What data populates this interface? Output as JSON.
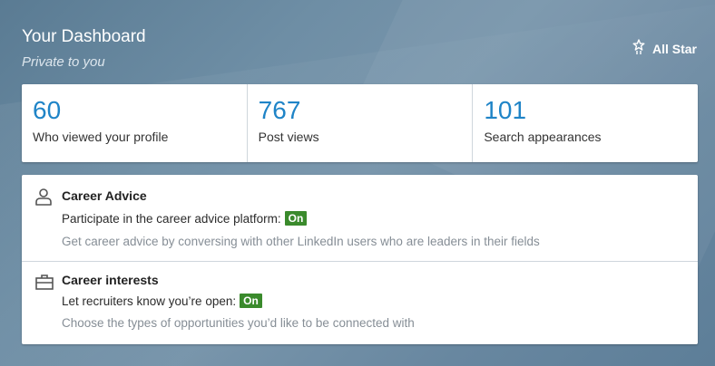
{
  "header": {
    "title": "Your Dashboard",
    "subtitle": "Private to you",
    "all_star_label": "All Star",
    "all_star_icon": "star-award-icon"
  },
  "stats": [
    {
      "value": "60",
      "label": "Who viewed your profile"
    },
    {
      "value": "767",
      "label": "Post views"
    },
    {
      "value": "101",
      "label": "Search appearances"
    }
  ],
  "career_advice": {
    "icon": "person-icon",
    "title": "Career Advice",
    "line": "Participate in the career advice platform:",
    "status": "On",
    "note": "Get career advice by conversing with other LinkedIn users who are leaders in their fields"
  },
  "career_interests": {
    "icon": "briefcase-icon",
    "title": "Career interests",
    "line": "Let recruiters know you’re open:",
    "status": "On",
    "note": "Choose the types of opportunities you’d like to be connected with"
  },
  "colors": {
    "accent_blue": "#1f84c7",
    "status_green": "#3a8a2c",
    "background": "#6e8ea5"
  }
}
